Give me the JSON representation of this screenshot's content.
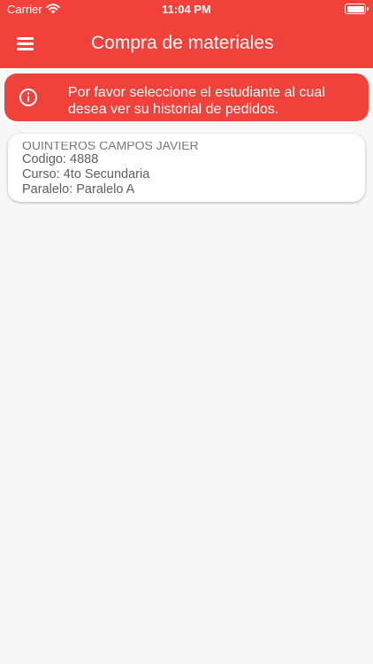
{
  "status_bar": {
    "carrier": "Carrier",
    "time": "11:04 PM"
  },
  "header": {
    "title": "Compra de materiales",
    "menu_icon": "hamburger-menu-icon"
  },
  "banner": {
    "icon": "info-icon",
    "message": "Por favor seleccione el estudiante al cual desea ver su historial de pedidos."
  },
  "student_card": {
    "name": "QUINTEROS CAMPOS JAVIER",
    "codigo": "Codigo: 4888",
    "curso": "Curso: 4to Secundaria",
    "paralelo": "Paralelo: Paralelo A"
  },
  "colors": {
    "accent": "#f2413a",
    "background": "#f7f7f7",
    "card": "#ffffff"
  }
}
